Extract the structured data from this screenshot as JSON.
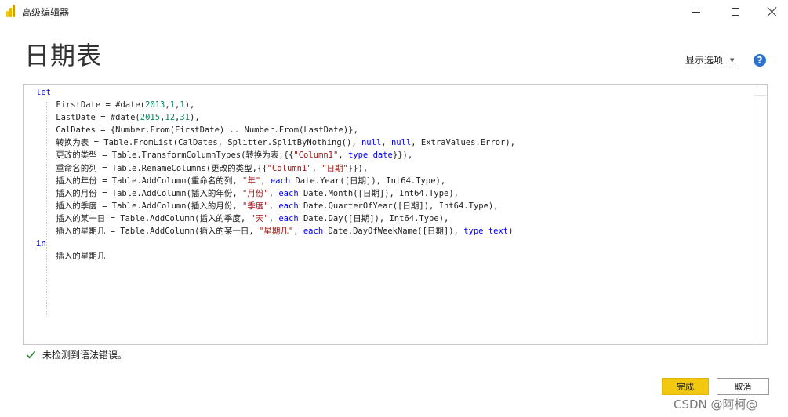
{
  "window": {
    "title": "高级编辑器",
    "minimize_icon": "minimize-icon",
    "maximize_icon": "maximize-icon",
    "close_icon": "close-icon"
  },
  "header": {
    "page_title": "日期表",
    "options_label": "显示选项",
    "help_glyph": "?"
  },
  "editor": {
    "lines": [
      [
        {
          "t": "let",
          "c": "kw"
        }
      ],
      [
        {
          "t": "    FirstDate = #date("
        },
        {
          "t": "2013",
          "c": "num"
        },
        {
          "t": ","
        },
        {
          "t": "1",
          "c": "num"
        },
        {
          "t": ","
        },
        {
          "t": "1",
          "c": "num"
        },
        {
          "t": "),"
        }
      ],
      [
        {
          "t": "    LastDate = #date("
        },
        {
          "t": "2015",
          "c": "num"
        },
        {
          "t": ","
        },
        {
          "t": "12",
          "c": "num"
        },
        {
          "t": ","
        },
        {
          "t": "31",
          "c": "num"
        },
        {
          "t": "),"
        }
      ],
      [
        {
          "t": "    CalDates = {Number.From(FirstDate) .. Number.From(LastDate)},"
        }
      ],
      [
        {
          "t": "    转换为表 = Table.FromList(CalDates, Splitter.SplitByNothing(), "
        },
        {
          "t": "null",
          "c": "kw"
        },
        {
          "t": ", "
        },
        {
          "t": "null",
          "c": "kw"
        },
        {
          "t": ", ExtraValues.Error),"
        }
      ],
      [
        {
          "t": "    更改的类型 = Table.TransformColumnTypes(转换为表,{{"
        },
        {
          "t": "\"Column1\"",
          "c": "str"
        },
        {
          "t": ", "
        },
        {
          "t": "type",
          "c": "kw"
        },
        {
          "t": " "
        },
        {
          "t": "date",
          "c": "kw"
        },
        {
          "t": "}}),"
        }
      ],
      [
        {
          "t": "    重命名的列 = Table.RenameColumns(更改的类型,{{"
        },
        {
          "t": "\"Column1\"",
          "c": "str"
        },
        {
          "t": ", "
        },
        {
          "t": "\"日期\"",
          "c": "str"
        },
        {
          "t": "}}),"
        }
      ],
      [
        {
          "t": "    插入的年份 = Table.AddColumn(重命名的列, "
        },
        {
          "t": "\"年\"",
          "c": "str"
        },
        {
          "t": ", "
        },
        {
          "t": "each",
          "c": "kw"
        },
        {
          "t": " Date.Year([日期]), Int64.Type),"
        }
      ],
      [
        {
          "t": "    插入的月份 = Table.AddColumn(插入的年份, "
        },
        {
          "t": "\"月份\"",
          "c": "str"
        },
        {
          "t": ", "
        },
        {
          "t": "each",
          "c": "kw"
        },
        {
          "t": " Date.Month([日期]), Int64.Type),"
        }
      ],
      [
        {
          "t": "    插入的季度 = Table.AddColumn(插入的月份, "
        },
        {
          "t": "\"季度\"",
          "c": "str"
        },
        {
          "t": ", "
        },
        {
          "t": "each",
          "c": "kw"
        },
        {
          "t": " Date.QuarterOfYear([日期]), Int64.Type),"
        }
      ],
      [
        {
          "t": "    插入的某一日 = Table.AddColumn(插入的季度, "
        },
        {
          "t": "\"天\"",
          "c": "str"
        },
        {
          "t": ", "
        },
        {
          "t": "each",
          "c": "kw"
        },
        {
          "t": " Date.Day([日期]), Int64.Type),"
        }
      ],
      [
        {
          "t": "    插入的星期几 = Table.AddColumn(插入的某一日, "
        },
        {
          "t": "\"星期几\"",
          "c": "str"
        },
        {
          "t": ", "
        },
        {
          "t": "each",
          "c": "kw"
        },
        {
          "t": " Date.DayOfWeekName([日期]), "
        },
        {
          "t": "type",
          "c": "kw"
        },
        {
          "t": " "
        },
        {
          "t": "text",
          "c": "kw"
        },
        {
          "t": ")"
        }
      ],
      [
        {
          "t": "in",
          "c": "kw"
        }
      ],
      [
        {
          "t": "    插入的星期几"
        }
      ]
    ]
  },
  "status": {
    "icon": "checkmark-icon",
    "message": "未检测到语法错误。"
  },
  "buttons": {
    "done_label": "完成",
    "cancel_label": "取消"
  },
  "watermark": "CSDN @阿柯@",
  "colors": {
    "accent": "#f2c811",
    "keyword": "#0000ff",
    "number": "#098658",
    "string": "#a31515",
    "success": "#3a8a3a",
    "help": "#2b73cc"
  }
}
